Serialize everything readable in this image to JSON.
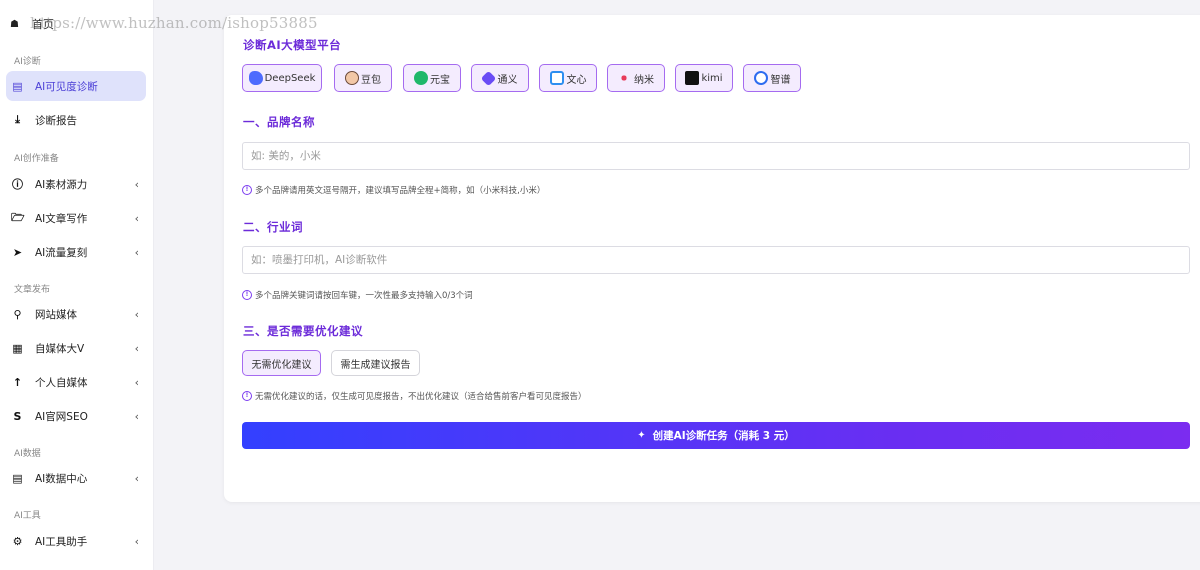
{
  "watermark": "https://www.huzhan.com/ishop53885",
  "sidebar": {
    "home_label": "首页",
    "sections": {
      "diagnose": "AI诊断",
      "create": "AI创作准备",
      "publish": "文章发布",
      "data": "AI数据",
      "tools": "AI工具"
    },
    "items": {
      "visibility": "AI可见度诊断",
      "report": "诊断报告",
      "material": "AI素材源力",
      "article": "AI文章写作",
      "traffic": "AI流量复刻",
      "site_media": "网站媒体",
      "self_media": "自媒体大V",
      "personal_media": "个人自媒体",
      "official_seo": "AI官网SEO",
      "data_center": "AI数据中心",
      "tool_helper": "AI工具助手"
    }
  },
  "main": {
    "platform_heading": "诊断AI大模型平台",
    "platforms": [
      "DeepSeek",
      "豆包",
      "元宝",
      "通义",
      "文心",
      "纳米",
      "kimi",
      "智谱"
    ],
    "brand": {
      "heading": "一、品牌名称",
      "placeholder": "如: 美的，小米",
      "hint": "多个品牌请用英文逗号隔开，建议填写品牌全程+简称，如（小米科技,小米）"
    },
    "industry": {
      "heading": "二、行业词",
      "placeholder": "如：喷墨打印机，AI诊断软件",
      "hint": "多个品牌关键词请按回车键，一次性最多支持输入0/3个词"
    },
    "optimize": {
      "heading": "三、是否需要优化建议",
      "options": [
        "无需优化建议",
        "需生成建议报告"
      ],
      "hint": "无需优化建议的话，仅生成可见度报告，不出优化建议（适合给售前客户看可见度报告）"
    },
    "submit_label": "创建AI诊断任务（消耗  3 元）"
  },
  "colors": {
    "accent": "#6c2bd9",
    "active_bg": "#dfe2fb",
    "button_gradient_start": "#3340ff",
    "button_gradient_end": "#7b2cf0"
  }
}
